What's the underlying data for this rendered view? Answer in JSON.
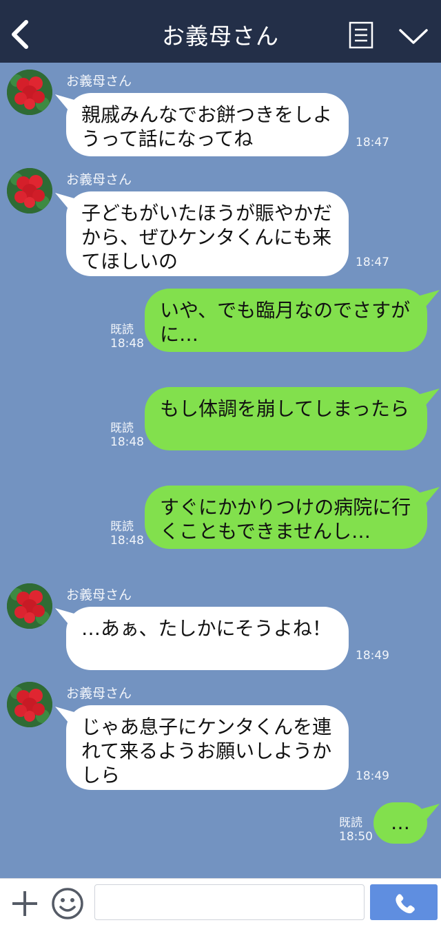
{
  "header": {
    "title": "お義母さん"
  },
  "messages": [
    {
      "type": "in",
      "sender": "お義母さん",
      "text": "親戚みんなでお餅つきをしようって話になってね",
      "time": "18:47"
    },
    {
      "type": "in",
      "sender": "お義母さん",
      "text": "子どもがいたほうが賑やかだから、ぜひケンタくんにも来てほしいの",
      "time": "18:47"
    },
    {
      "type": "out",
      "read": "既読",
      "text": "いや、でも臨月なのでさすがに…",
      "time": "18:48"
    },
    {
      "type": "out",
      "read": "既読",
      "text": "もし体調を崩してしまったら",
      "time": "18:48"
    },
    {
      "type": "out",
      "read": "既読",
      "text": "すぐにかかりつけの病院に行くこともできませんし…",
      "time": "18:48"
    },
    {
      "type": "in",
      "sender": "お義母さん",
      "text": "…あぁ、たしかにそうよね！",
      "time": "18:49"
    },
    {
      "type": "in",
      "sender": "お義母さん",
      "text": "じゃあ息子にケンタくんを連れて来るようお願いしようかしら",
      "time": "18:49"
    },
    {
      "type": "out",
      "read": "既読",
      "text": "…",
      "time": "18:50"
    }
  ],
  "input": {
    "placeholder": ""
  },
  "colors": {
    "header": "#232f48",
    "background": "#7393c1",
    "outgoing": "#82e04d",
    "incoming": "#ffffff",
    "send": "#5f8ee0"
  }
}
